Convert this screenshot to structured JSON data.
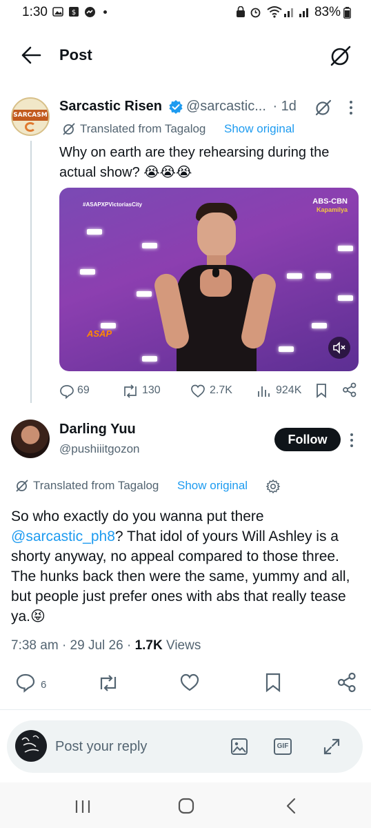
{
  "status_bar": {
    "time": "1:30",
    "battery": "83%"
  },
  "header": {
    "title": "Post",
    "back_icon": "arrow-left-icon",
    "grok_icon": "grok-icon"
  },
  "tweet": {
    "author_name": "Sarcastic Risen",
    "handle": "@sarcastic...",
    "age": "· 1d",
    "avatar_text": "SARCASM",
    "verified": true,
    "translated_label": "Translated from Tagalog",
    "show_original": "Show original",
    "text": "Why on earth are they rehearsing during the actual show? 😭😭😭",
    "media": {
      "overlay_tag": "#ASAPXPVictoriasCity",
      "channel_logo": "ABS-CBN",
      "channel_sub": "Kapamilya",
      "show_logo": "ASAP"
    },
    "actions": {
      "replies": "69",
      "reposts": "130",
      "likes": "2.7K",
      "views": "924K"
    }
  },
  "reply": {
    "author_name": "Darling Yuu",
    "handle": "@pushiiitgozon",
    "follow_label": "Follow",
    "translated_label": "Translated from Tagalog",
    "show_original": "Show original",
    "text_before_mention": "So who exactly do you wanna put there ",
    "mention": "@sarcastic_ph8",
    "text_after_mention": "? That idol of yours Will Ashley is a shorty anyway, no appeal compared to those three. The hunks back then were the same, yummy and all, but people just prefer ones with abs that really tease ya.😝",
    "time": "7:38 am",
    "date": "29 Jul 26",
    "views_count": "1.7K",
    "views_label": "Views",
    "reply_count": "6"
  },
  "reply_bar": {
    "placeholder": "Post your reply",
    "gif_label": "GIF"
  },
  "colors": {
    "accent": "#1d9bf0",
    "text": "#0f1419",
    "muted": "#536471",
    "follow_bg": "#0f1419"
  }
}
